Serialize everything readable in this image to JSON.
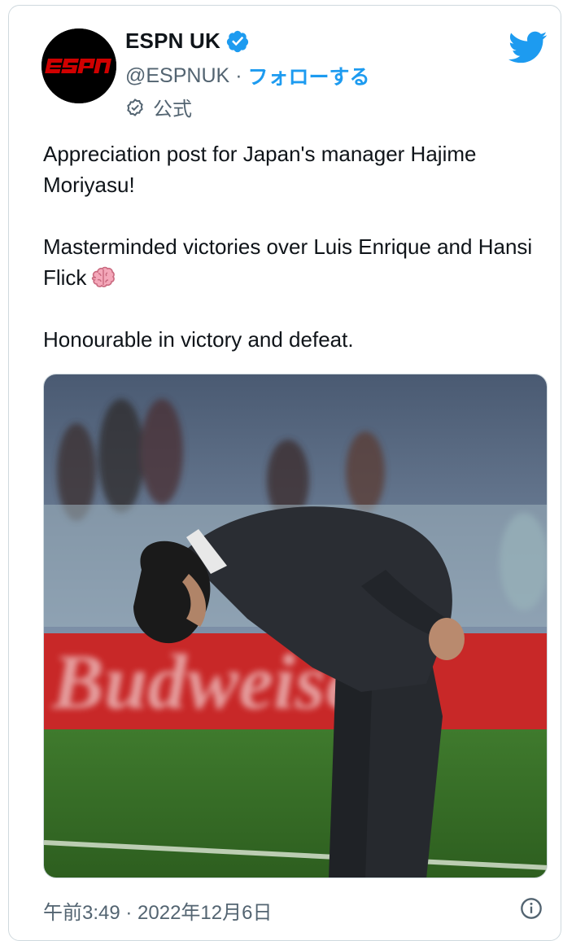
{
  "account": {
    "display_name": "ESPN UK",
    "handle": "@ESPNUK",
    "separator": "·",
    "follow_label": "フォローする",
    "official_label": "公式",
    "avatar_logo_text": "ESPN"
  },
  "tweet": {
    "paragraph1": "Appreciation post for Japan's manager Hajime Moriyasu!",
    "paragraph2": "Masterminded victories over Luis Enrique and Hansi Flick",
    "paragraph2_emoji": "brain-icon",
    "paragraph3": "Honourable in victory and defeat."
  },
  "media": {
    "banner_text": "Budweiser"
  },
  "footer": {
    "timestamp": "午前3:49 · 2022年12月6日"
  },
  "icons": {
    "verified": "verified-badge-icon",
    "official": "official-check-icon",
    "brand": "twitter-bird-icon",
    "info": "info-icon"
  },
  "colors": {
    "accent": "#1d9bf0",
    "text": "#0f1419",
    "secondary": "#536471",
    "espn_red": "#d00000"
  }
}
